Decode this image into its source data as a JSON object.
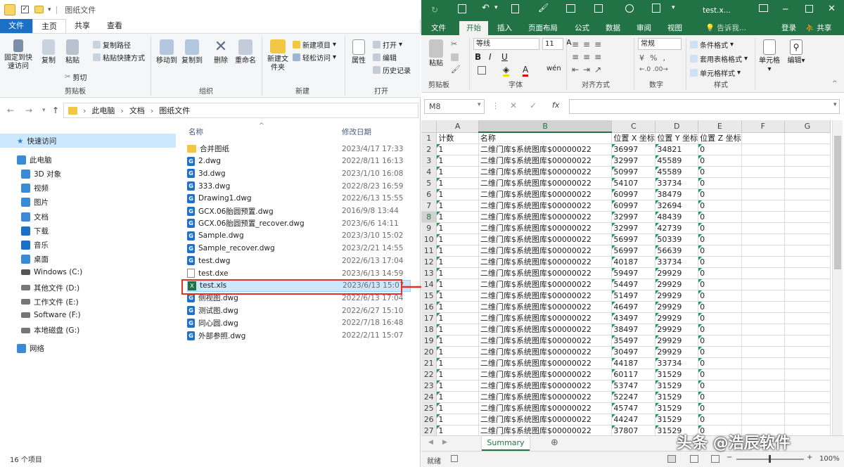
{
  "explorer": {
    "title": "图纸文件",
    "tabs": [
      "文件",
      "主页",
      "共享",
      "查看"
    ],
    "ribbon": {
      "pin_label": "固定到快速访问",
      "copy_label": "复制",
      "paste_label": "粘贴",
      "copy_path": "复制路径",
      "paste_shortcut": "粘贴快捷方式",
      "cut": "剪切",
      "clipboard_group": "剪贴板",
      "move_to": "移动到",
      "copy_to": "复制到",
      "delete": "删除",
      "rename": "重命名",
      "organize_group": "组织",
      "new_item": "新建项目",
      "easy_access": "轻松访问",
      "new_folder": "新建文件夹",
      "new_group": "新建",
      "properties": "属性",
      "open": "打开",
      "edit": "编辑",
      "history": "历史记录",
      "open_group": "打开"
    },
    "breadcrumb": [
      "此电脑",
      "文档",
      "图纸文件"
    ],
    "nav": {
      "quick_access": "快速访问",
      "this_pc": "此电脑",
      "items": [
        "3D 对象",
        "视频",
        "图片",
        "文档",
        "下载",
        "音乐",
        "桌面",
        "Windows (C:)",
        "其他文件 (D:)",
        "工作文件 (E:)",
        "Software (F:)",
        "本地磁盘 (G:)"
      ],
      "network": "网络"
    },
    "columns": {
      "name": "名称",
      "date": "修改日期"
    },
    "files": [
      {
        "name": "合并图纸",
        "date": "2023/4/17 17:33",
        "type": "folder"
      },
      {
        "name": "2.dwg",
        "date": "2022/8/11 16:13",
        "type": "dwg"
      },
      {
        "name": "3d.dwg",
        "date": "2023/1/10 16:08",
        "type": "dwg"
      },
      {
        "name": "333.dwg",
        "date": "2022/8/23 16:59",
        "type": "dwg"
      },
      {
        "name": "Drawing1.dwg",
        "date": "2022/6/13 15:55",
        "type": "dwg"
      },
      {
        "name": "GCX.06胎圆预置.dwg",
        "date": "2016/9/8 13:44",
        "type": "dwg"
      },
      {
        "name": "GCX.06胎圆预置_recover.dwg",
        "date": "2023/6/6 14:11",
        "type": "dwg"
      },
      {
        "name": "Sample.dwg",
        "date": "2023/3/10 15:02",
        "type": "dwg"
      },
      {
        "name": "Sample_recover.dwg",
        "date": "2023/2/21 14:55",
        "type": "dwg"
      },
      {
        "name": "test.dwg",
        "date": "2022/6/13 17:04",
        "type": "dwg"
      },
      {
        "name": "test.dxe",
        "date": "2023/6/13 14:59",
        "type": "dxe"
      },
      {
        "name": "test.xls",
        "date": "2023/6/13 15:07",
        "type": "xls"
      },
      {
        "name": "侧视图.dwg",
        "date": "2022/6/13 17:04",
        "type": "dwg"
      },
      {
        "name": "测试图.dwg",
        "date": "2022/6/27 15:10",
        "type": "dwg"
      },
      {
        "name": "同心圆.dwg",
        "date": "2022/7/18 16:48",
        "type": "dwg"
      },
      {
        "name": "外部参照.dwg",
        "date": "2022/2/11 15:07",
        "type": "dwg"
      }
    ],
    "status": "16 个项目"
  },
  "excel": {
    "title": "test.x...",
    "tabs": [
      "文件",
      "开始",
      "插入",
      "页面布局",
      "公式",
      "数据",
      "审阅",
      "视图"
    ],
    "tell_me": "告诉我...",
    "login": "登录",
    "share": "共享",
    "ribbon": {
      "paste": "粘贴",
      "clipboard": "剪贴板",
      "font_name": "等线",
      "font_size": "11",
      "font_group": "字体",
      "align_group": "对齐方式",
      "number_format": "常规",
      "number_group": "数字",
      "cond_format": "条件格式",
      "table_format": "套用表格格式",
      "cell_style": "单元格样式",
      "style_group": "样式",
      "cells": "单元格",
      "editing": "编辑"
    },
    "namebox": "M8",
    "col_headers": [
      "A",
      "B",
      "C",
      "D",
      "E",
      "F",
      "G"
    ],
    "header_row": [
      "计数",
      "名称",
      "位置 X 坐标",
      "位置 Y 坐标",
      "位置 Z 坐标",
      "",
      ""
    ],
    "rows": [
      [
        "1",
        "二维门库$系统图库$00000022",
        "36997",
        "34821",
        "0"
      ],
      [
        "1",
        "二维门库$系统图库$00000022",
        "32997",
        "45589",
        "0"
      ],
      [
        "1",
        "二维门库$系统图库$00000022",
        "50997",
        "45589",
        "0"
      ],
      [
        "1",
        "二维门库$系统图库$00000022",
        "54107",
        "33734",
        "0"
      ],
      [
        "1",
        "二维门库$系统图库$00000022",
        "60997",
        "38479",
        "0"
      ],
      [
        "1",
        "二维门库$系统图库$00000022",
        "60997",
        "32694",
        "0"
      ],
      [
        "1",
        "二维门库$系统图库$00000022",
        "32997",
        "48439",
        "0"
      ],
      [
        "1",
        "二维门库$系统图库$00000022",
        "32997",
        "42739",
        "0"
      ],
      [
        "1",
        "二维门库$系统图库$00000022",
        "56997",
        "50339",
        "0"
      ],
      [
        "1",
        "二维门库$系统图库$00000022",
        "56997",
        "56639",
        "0"
      ],
      [
        "1",
        "二维门库$系统图库$00000022",
        "40187",
        "33734",
        "0"
      ],
      [
        "1",
        "二维门库$系统图库$00000022",
        "59497",
        "29929",
        "0"
      ],
      [
        "1",
        "二维门库$系统图库$00000022",
        "54497",
        "29929",
        "0"
      ],
      [
        "1",
        "二维门库$系统图库$00000022",
        "51497",
        "29929",
        "0"
      ],
      [
        "1",
        "二维门库$系统图库$00000022",
        "46497",
        "29929",
        "0"
      ],
      [
        "1",
        "二维门库$系统图库$00000022",
        "43497",
        "29929",
        "0"
      ],
      [
        "1",
        "二维门库$系统图库$00000022",
        "38497",
        "29929",
        "0"
      ],
      [
        "1",
        "二维门库$系统图库$00000022",
        "35497",
        "29929",
        "0"
      ],
      [
        "1",
        "二维门库$系统图库$00000022",
        "30497",
        "29929",
        "0"
      ],
      [
        "1",
        "二维门库$系统图库$00000022",
        "44187",
        "33734",
        "0"
      ],
      [
        "1",
        "二维门库$系统图库$00000022",
        "60117",
        "31529",
        "0"
      ],
      [
        "1",
        "二维门库$系统图库$00000022",
        "53747",
        "31529",
        "0"
      ],
      [
        "1",
        "二维门库$系统图库$00000022",
        "52247",
        "31529",
        "0"
      ],
      [
        "1",
        "二维门库$系统图库$00000022",
        "45747",
        "31529",
        "0"
      ],
      [
        "1",
        "二维门库$系统图库$00000022",
        "44247",
        "31529",
        "0"
      ],
      [
        "1",
        "二维门库$系统图库$00000022",
        "37807",
        "31529",
        "0"
      ]
    ],
    "sheet_tab": "Summary",
    "status_ready": "就绪",
    "zoom": "100%"
  },
  "watermark": "头条 @浩辰软件",
  "colors": {
    "excel_green": "#217346",
    "explorer_blue": "#1a6fc6",
    "highlight_red": "#e53228"
  }
}
